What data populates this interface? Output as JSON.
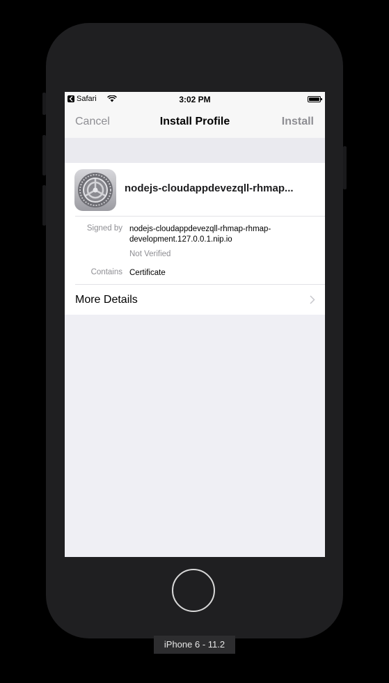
{
  "status_bar": {
    "back_app": "Safari",
    "time": "3:02 PM"
  },
  "nav": {
    "cancel": "Cancel",
    "title": "Install Profile",
    "install": "Install"
  },
  "profile": {
    "name": "nodejs-cloudappdevezqll-rhmap...",
    "icon": "settings-gear-icon",
    "signed_by_label": "Signed by",
    "signed_by_value": "nodejs-cloudappdevezqll-rhmap-rhmap-development.127.0.0.1.nip.io",
    "verification": "Not Verified",
    "contains_label": "Contains",
    "contains_value": "Certificate"
  },
  "more_details": {
    "label": "More Details"
  },
  "device": {
    "label": "iPhone 6 - 11.2"
  },
  "colors": {
    "accent_disabled": "#8e8e93",
    "background": "#efeff4",
    "phone": "#1f1f21"
  }
}
